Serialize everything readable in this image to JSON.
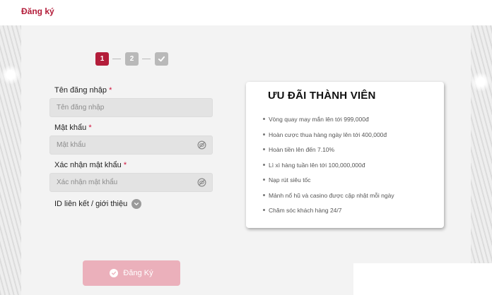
{
  "header": {
    "title": "Đăng ký"
  },
  "stepper": {
    "steps": [
      {
        "label": "1",
        "state": "active"
      },
      {
        "label": "2",
        "state": "inactive"
      },
      {
        "label": "",
        "icon": "check-icon",
        "state": "inactive"
      }
    ],
    "active_color": "#b31d3a",
    "inactive_color": "#b9b9b9"
  },
  "form": {
    "username": {
      "label": "Tên đăng nhập",
      "required_mark": "*",
      "placeholder": "Tên đăng nhập",
      "value": ""
    },
    "password": {
      "label": "Mật khẩu",
      "required_mark": "*",
      "placeholder": "Mật khẩu",
      "value": "",
      "toggle_icon": "eye-slash-icon"
    },
    "confirm_password": {
      "label": "Xác nhận mật khẩu",
      "required_mark": "*",
      "placeholder": "Xác nhận mật khẩu",
      "value": "",
      "toggle_icon": "eye-slash-icon"
    },
    "referral": {
      "label": "ID liên kết / giới thiệu",
      "icon": "chevron-down-icon"
    },
    "submit": {
      "label": "Đăng Ký",
      "icon": "check-circle-icon",
      "color": "#ebb0bb"
    }
  },
  "benefits": {
    "title": "ƯU ĐÃI THÀNH VIÊN",
    "items": [
      "Vòng quay may mắn lên tới 999,000đ",
      "Hoàn cược thua hàng ngày lên tới 400,000đ",
      "Hoàn tiền lên đến 7.10%",
      "Lì xì hàng tuần lên tới 100,000,000đ",
      "Nạp rút siêu tốc",
      "Mảnh nổ hũ và casino được cập nhật mỗi ngày",
      "Chăm sóc khách hàng 24/7"
    ]
  },
  "colors": {
    "brand": "#b31d3a",
    "required": "#d0113a"
  }
}
